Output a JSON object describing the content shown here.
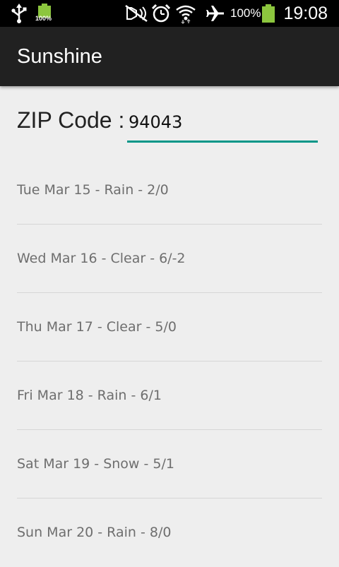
{
  "status_bar": {
    "battery_small_label": "100%",
    "battery_percent": "100%",
    "time": "19:08",
    "icons": [
      "usb-icon",
      "battery-small-icon",
      "mute-icon",
      "alarm-icon",
      "wifi-icon",
      "airplane-icon",
      "battery-icon"
    ],
    "colors": {
      "battery": "#8cc63e"
    }
  },
  "action_bar": {
    "title": "Sunshine"
  },
  "zip": {
    "label": "ZIP Code :",
    "value": "94043"
  },
  "forecast": [
    {
      "text": "Tue Mar 15 - Rain - 2/0"
    },
    {
      "text": "Wed Mar 16 - Clear - 6/-2"
    },
    {
      "text": "Thu Mar 17 - Clear - 5/0"
    },
    {
      "text": "Fri Mar 18 - Rain - 6/1"
    },
    {
      "text": "Sat Mar 19 - Snow - 5/1"
    },
    {
      "text": "Sun Mar 20 - Rain - 8/0"
    }
  ],
  "colors": {
    "accent": "#009688",
    "action_bar": "#212121",
    "background": "#eeeeee"
  }
}
